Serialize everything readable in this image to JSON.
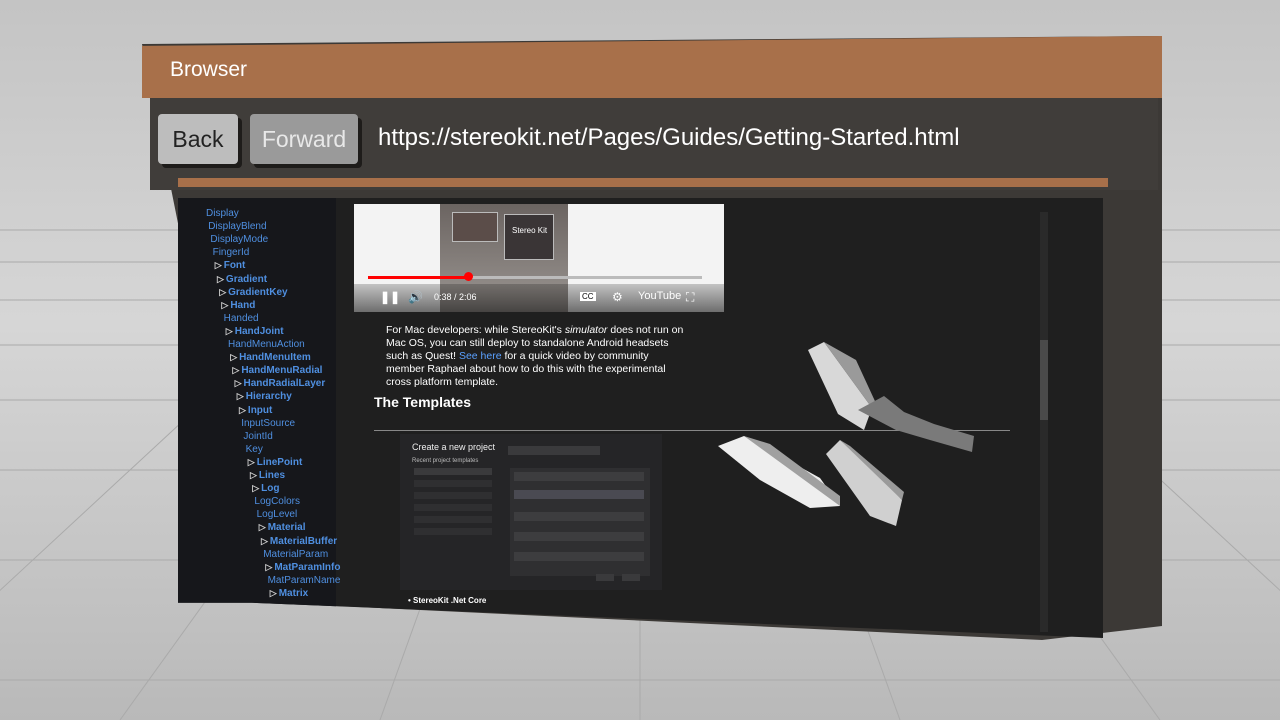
{
  "window": {
    "title": "Browser"
  },
  "toolbar": {
    "back_label": "Back",
    "forward_label": "Forward",
    "url": "https://stereokit.net/Pages/Guides/Getting-Started.html"
  },
  "sidebar": {
    "items": [
      {
        "label": "Display",
        "bold": false,
        "expand": false
      },
      {
        "label": "DisplayBlend",
        "bold": false,
        "expand": false
      },
      {
        "label": "DisplayMode",
        "bold": false,
        "expand": false
      },
      {
        "label": "FingerId",
        "bold": false,
        "expand": false
      },
      {
        "label": "Font",
        "bold": true,
        "expand": true
      },
      {
        "label": "Gradient",
        "bold": true,
        "expand": true
      },
      {
        "label": "GradientKey",
        "bold": true,
        "expand": true
      },
      {
        "label": "Hand",
        "bold": true,
        "expand": true
      },
      {
        "label": "Handed",
        "bold": false,
        "expand": false
      },
      {
        "label": "HandJoint",
        "bold": true,
        "expand": true
      },
      {
        "label": "HandMenuAction",
        "bold": false,
        "expand": false
      },
      {
        "label": "HandMenuItem",
        "bold": true,
        "expand": true
      },
      {
        "label": "HandMenuRadial",
        "bold": true,
        "expand": true
      },
      {
        "label": "HandRadialLayer",
        "bold": true,
        "expand": true
      },
      {
        "label": "Hierarchy",
        "bold": true,
        "expand": true
      },
      {
        "label": "Input",
        "bold": true,
        "expand": true
      },
      {
        "label": "InputSource",
        "bold": false,
        "expand": false
      },
      {
        "label": "JointId",
        "bold": false,
        "expand": false
      },
      {
        "label": "Key",
        "bold": false,
        "expand": false
      },
      {
        "label": "LinePoint",
        "bold": true,
        "expand": true
      },
      {
        "label": "Lines",
        "bold": true,
        "expand": true
      },
      {
        "label": "Log",
        "bold": true,
        "expand": true
      },
      {
        "label": "LogColors",
        "bold": false,
        "expand": false
      },
      {
        "label": "LogLevel",
        "bold": false,
        "expand": false
      },
      {
        "label": "Material",
        "bold": true,
        "expand": true
      },
      {
        "label": "MaterialBuffer",
        "bold": true,
        "expand": true
      },
      {
        "label": "MaterialParam",
        "bold": false,
        "expand": false
      },
      {
        "label": "MatParamInfo",
        "bold": true,
        "expand": true
      },
      {
        "label": "MatParamName",
        "bold": false,
        "expand": false
      },
      {
        "label": "Matrix",
        "bold": true,
        "expand": true
      }
    ]
  },
  "video": {
    "time": "0:38 / 2:06",
    "brand": "YouTube",
    "progress": 0.3,
    "thumb_label": "Stereo Kit"
  },
  "article": {
    "para_1": "For Mac developers: while StereoKit's ",
    "para_em": "simulator",
    "para_2": " does not run on Mac OS, you can still deploy to standalone Android headsets such as Quest! ",
    "para_link": "See here",
    "para_3": " for a quick video by community member Raphael about how to do this with the experimental cross platform template.",
    "heading": "The Templates",
    "dialog_title": "Create a new project",
    "dialog_sub": "Recent project templates",
    "bullet": "StereoKit .Net Core"
  },
  "colors": {
    "accent": "#a8704a",
    "link": "#4f8fe0",
    "panel": "#3c3936"
  }
}
